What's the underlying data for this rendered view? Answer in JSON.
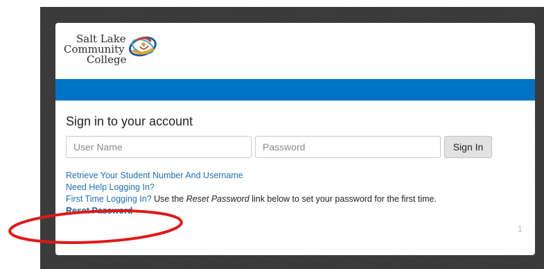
{
  "logo": {
    "line1": "Salt Lake",
    "line2": "Community",
    "line3": "College"
  },
  "login": {
    "heading": "Sign in to your account",
    "username_placeholder": "User Name",
    "username_value": "",
    "password_placeholder": "Password",
    "password_value": "",
    "signin_label": "Sign In"
  },
  "links": {
    "retrieve": "Retrieve Your Student Number And Username",
    "need_help": "Need Help Logging In?",
    "first_time": "First Time Logging In?",
    "first_time_pre": " Use the ",
    "first_time_em": "Reset Password",
    "first_time_post": " link below to set your password for the first time.",
    "reset": "Reset Password"
  },
  "page_number": "1",
  "colors": {
    "brand_blue": "#0073c6",
    "link_blue": "#1f6fae",
    "annotation_red": "#e01818"
  }
}
